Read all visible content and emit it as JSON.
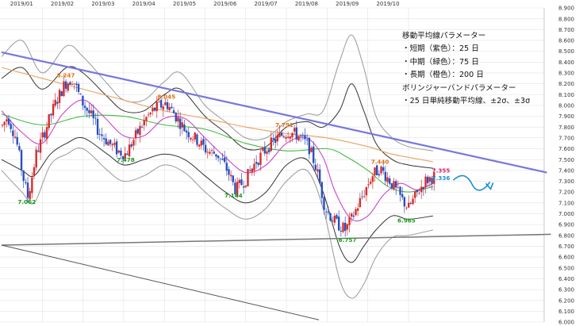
{
  "chart_data": {
    "type": "candlestick",
    "x_ticks": [
      "2019/01",
      "2019/02",
      "2019/03",
      "2019/04",
      "2019/05",
      "2019/06",
      "2019/07",
      "2019/08",
      "2019/09",
      "2019/10"
    ],
    "y_ticks": [
      "8.900",
      "8.800",
      "8.700",
      "8.600",
      "8.500",
      "8.400",
      "8.300",
      "8.200",
      "8.100",
      "8.000",
      "7.900",
      "7.800",
      "7.700",
      "7.600",
      "7.500",
      "7.400",
      "7.300",
      "7.200",
      "7.100",
      "7.000",
      "6.900",
      "6.800",
      "6.700",
      "6.600",
      "6.500",
      "6.400",
      "6.300",
      "6.200",
      "6.100",
      "6.000"
    ],
    "ylim": [
      6.0,
      8.9
    ],
    "grid": true,
    "legend": {
      "position": "top-right",
      "lines": [
        "移動平均線パラメーター",
        "・短期（紫色）：25 日",
        "・中期（緑色）：75 日",
        "・長期（橙色）：200 日",
        "ボリンジャーバンドパラメーター",
        "・25 日単純移動平均線、±2σ、±3σ"
      ]
    },
    "annotations": [
      {
        "label": "7.062",
        "month": 0.62,
        "value": 7.09,
        "color": "#1a9a1a"
      },
      {
        "label": "8.247",
        "month": 1.58,
        "value": 8.26,
        "color": "#e07010"
      },
      {
        "label": "7.478",
        "month": 3.05,
        "value": 7.48,
        "color": "#1a9a1a"
      },
      {
        "label": "8.045",
        "month": 4.05,
        "value": 8.06,
        "color": "#e07010"
      },
      {
        "label": "7.144",
        "month": 5.7,
        "value": 7.15,
        "color": "#1a9a1a"
      },
      {
        "label": "7.791",
        "month": 6.95,
        "value": 7.8,
        "color": "#e07010"
      },
      {
        "label": "6.757",
        "month": 8.5,
        "value": 6.74,
        "color": "#1a9a1a"
      },
      {
        "label": "7.440",
        "month": 9.3,
        "value": 7.46,
        "color": "#e07010"
      },
      {
        "label": "6.965",
        "month": 9.95,
        "value": 6.92,
        "color": "#1a9a1a"
      },
      {
        "label": "7.355",
        "month": 10.8,
        "value": 7.38,
        "color": "#e0206a"
      },
      {
        "label": "7.336",
        "month": 10.8,
        "value": 7.31,
        "color": "#1a8fd0"
      }
    ],
    "price_points": [
      [
        0.0,
        7.8
      ],
      [
        0.15,
        7.9
      ],
      [
        0.35,
        7.7
      ],
      [
        0.55,
        7.3
      ],
      [
        0.65,
        7.15
      ],
      [
        0.85,
        7.55
      ],
      [
        1.05,
        7.75
      ],
      [
        1.3,
        8.0
      ],
      [
        1.55,
        8.2
      ],
      [
        1.75,
        8.25
      ],
      [
        1.95,
        8.05
      ],
      [
        2.2,
        7.9
      ],
      [
        2.4,
        7.75
      ],
      [
        2.65,
        7.65
      ],
      [
        2.85,
        7.58
      ],
      [
        3.05,
        7.55
      ],
      [
        3.3,
        7.72
      ],
      [
        3.55,
        7.88
      ],
      [
        3.8,
        7.98
      ],
      [
        4.05,
        8.02
      ],
      [
        4.25,
        7.92
      ],
      [
        4.5,
        7.78
      ],
      [
        4.8,
        7.68
      ],
      [
        5.05,
        7.58
      ],
      [
        5.3,
        7.55
      ],
      [
        5.55,
        7.4
      ],
      [
        5.75,
        7.22
      ],
      [
        6.0,
        7.32
      ],
      [
        6.25,
        7.48
      ],
      [
        6.55,
        7.62
      ],
      [
        6.85,
        7.72
      ],
      [
        7.05,
        7.76
      ],
      [
        7.3,
        7.72
      ],
      [
        7.55,
        7.62
      ],
      [
        7.75,
        7.4
      ],
      [
        7.95,
        7.05
      ],
      [
        8.2,
        6.92
      ],
      [
        8.45,
        6.85
      ],
      [
        8.6,
        6.95
      ],
      [
        8.85,
        7.15
      ],
      [
        9.1,
        7.35
      ],
      [
        9.3,
        7.42
      ],
      [
        9.55,
        7.3
      ],
      [
        9.8,
        7.15
      ],
      [
        10.0,
        7.05
      ],
      [
        10.2,
        7.18
      ],
      [
        10.4,
        7.3
      ],
      [
        10.65,
        7.35
      ]
    ],
    "ma_short_purple": [
      [
        0.0,
        7.95
      ],
      [
        0.5,
        7.75
      ],
      [
        1.0,
        7.65
      ],
      [
        1.5,
        7.92
      ],
      [
        2.0,
        8.05
      ],
      [
        2.5,
        7.9
      ],
      [
        3.0,
        7.72
      ],
      [
        3.5,
        7.72
      ],
      [
        4.0,
        7.88
      ],
      [
        4.5,
        7.88
      ],
      [
        5.0,
        7.7
      ],
      [
        5.5,
        7.52
      ],
      [
        6.0,
        7.38
      ],
      [
        6.5,
        7.45
      ],
      [
        7.0,
        7.65
      ],
      [
        7.5,
        7.7
      ],
      [
        7.9,
        7.52
      ],
      [
        8.2,
        7.2
      ],
      [
        8.6,
        6.95
      ],
      [
        9.0,
        6.98
      ],
      [
        9.4,
        7.18
      ],
      [
        9.8,
        7.28
      ],
      [
        10.2,
        7.22
      ],
      [
        10.6,
        7.28
      ]
    ],
    "ma_mid_green": [
      [
        0.0,
        7.92
      ],
      [
        1.0,
        7.82
      ],
      [
        2.0,
        7.9
      ],
      [
        3.0,
        7.9
      ],
      [
        4.0,
        7.82
      ],
      [
        5.0,
        7.78
      ],
      [
        6.0,
        7.65
      ],
      [
        7.0,
        7.58
      ],
      [
        8.0,
        7.6
      ],
      [
        8.5,
        7.52
      ],
      [
        9.0,
        7.4
      ],
      [
        9.5,
        7.25
      ],
      [
        10.0,
        7.2
      ],
      [
        10.6,
        7.25
      ]
    ],
    "ma_long_orange": [
      [
        0.0,
        8.35
      ],
      [
        1.0,
        8.25
      ],
      [
        2.0,
        8.15
      ],
      [
        3.0,
        8.05
      ],
      [
        4.0,
        7.95
      ],
      [
        5.0,
        7.88
      ],
      [
        6.0,
        7.8
      ],
      [
        7.0,
        7.74
      ],
      [
        8.0,
        7.7
      ],
      [
        9.0,
        7.62
      ],
      [
        9.6,
        7.55
      ],
      [
        10.6,
        7.48
      ]
    ],
    "band_upper_3sigma": [
      [
        0.0,
        8.45
      ],
      [
        0.5,
        8.6
      ],
      [
        1.0,
        8.3
      ],
      [
        1.6,
        8.55
      ],
      [
        2.0,
        8.45
      ],
      [
        2.6,
        8.2
      ],
      [
        3.0,
        8.05
      ],
      [
        3.5,
        8.05
      ],
      [
        4.0,
        8.22
      ],
      [
        4.4,
        8.3
      ],
      [
        5.0,
        8.0
      ],
      [
        5.5,
        7.85
      ],
      [
        6.0,
        7.7
      ],
      [
        6.5,
        7.7
      ],
      [
        7.0,
        7.85
      ],
      [
        7.5,
        7.92
      ],
      [
        7.9,
        7.95
      ],
      [
        8.3,
        8.4
      ],
      [
        8.6,
        8.65
      ],
      [
        8.9,
        8.35
      ],
      [
        9.2,
        7.9
      ],
      [
        9.6,
        7.7
      ],
      [
        10.0,
        7.62
      ],
      [
        10.6,
        7.58
      ]
    ],
    "band_upper_2sigma": [
      [
        0.0,
        8.25
      ],
      [
        0.5,
        8.35
      ],
      [
        1.0,
        8.15
      ],
      [
        1.6,
        8.35
      ],
      [
        2.0,
        8.3
      ],
      [
        2.6,
        8.08
      ],
      [
        3.0,
        7.95
      ],
      [
        3.5,
        7.95
      ],
      [
        4.0,
        8.1
      ],
      [
        4.4,
        8.15
      ],
      [
        5.0,
        7.9
      ],
      [
        5.5,
        7.75
      ],
      [
        6.0,
        7.6
      ],
      [
        6.5,
        7.62
      ],
      [
        7.0,
        7.8
      ],
      [
        7.5,
        7.85
      ],
      [
        7.9,
        7.8
      ],
      [
        8.3,
        7.95
      ],
      [
        8.6,
        8.2
      ],
      [
        8.9,
        7.95
      ],
      [
        9.2,
        7.65
      ],
      [
        9.6,
        7.5
      ],
      [
        10.0,
        7.45
      ],
      [
        10.6,
        7.42
      ]
    ],
    "band_lower_2sigma": [
      [
        0.0,
        7.5
      ],
      [
        0.5,
        7.4
      ],
      [
        0.8,
        7.35
      ],
      [
        1.2,
        7.55
      ],
      [
        1.6,
        7.65
      ],
      [
        2.0,
        7.7
      ],
      [
        2.6,
        7.55
      ],
      [
        3.0,
        7.45
      ],
      [
        3.5,
        7.5
      ],
      [
        4.0,
        7.55
      ],
      [
        4.5,
        7.5
      ],
      [
        5.0,
        7.35
      ],
      [
        5.5,
        7.2
      ],
      [
        6.0,
        7.1
      ],
      [
        6.5,
        7.2
      ],
      [
        7.0,
        7.45
      ],
      [
        7.5,
        7.5
      ],
      [
        7.9,
        7.2
      ],
      [
        8.3,
        6.7
      ],
      [
        8.6,
        6.55
      ],
      [
        8.9,
        6.7
      ],
      [
        9.2,
        6.85
      ],
      [
        9.6,
        6.98
      ],
      [
        10.0,
        6.95
      ],
      [
        10.6,
        6.98
      ]
    ],
    "band_lower_3sigma": [
      [
        0.0,
        7.4
      ],
      [
        0.5,
        7.2
      ],
      [
        0.8,
        7.1
      ],
      [
        1.2,
        7.45
      ],
      [
        1.6,
        7.55
      ],
      [
        2.0,
        7.6
      ],
      [
        2.6,
        7.4
      ],
      [
        3.0,
        7.3
      ],
      [
        3.5,
        7.35
      ],
      [
        4.0,
        7.45
      ],
      [
        4.5,
        7.38
      ],
      [
        5.0,
        7.2
      ],
      [
        5.5,
        7.05
      ],
      [
        6.0,
        6.95
      ],
      [
        6.5,
        7.05
      ],
      [
        7.0,
        7.3
      ],
      [
        7.5,
        7.4
      ],
      [
        7.9,
        7.05
      ],
      [
        8.3,
        6.4
      ],
      [
        8.6,
        6.22
      ],
      [
        8.9,
        6.35
      ],
      [
        9.2,
        6.6
      ],
      [
        9.6,
        6.78
      ],
      [
        10.0,
        6.8
      ],
      [
        10.6,
        6.85
      ]
    ],
    "trendlines": [
      {
        "name": "resistance",
        "color": "#7777dd",
        "width": 2.2,
        "from": [
          0.0,
          8.49
        ],
        "to": [
          13.4,
          7.38
        ]
      },
      {
        "name": "support",
        "color": "#777777",
        "width": 1.5,
        "from": [
          0.0,
          6.71
        ],
        "to": [
          13.5,
          6.81
        ]
      },
      {
        "name": "lower-channel",
        "color": "#555555",
        "width": 1.0,
        "from": [
          0.0,
          6.71
        ],
        "to": [
          7.8,
          6.02
        ]
      }
    ],
    "forecast_arrow": {
      "color": "#1a8fd0",
      "from": [
        11.1,
        7.31
      ],
      "to": [
        12.0,
        7.25
      ]
    }
  }
}
